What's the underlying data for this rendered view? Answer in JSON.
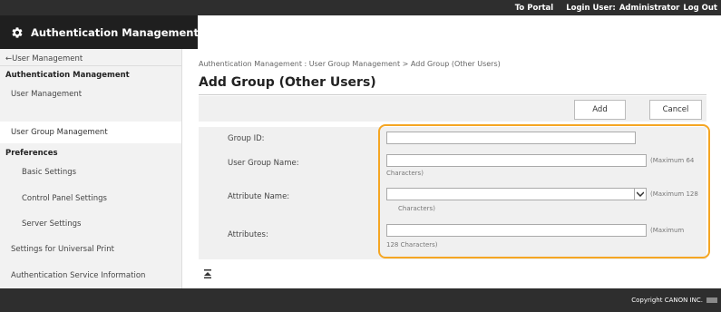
{
  "header": {
    "portal_link": "To Portal",
    "login_user_label": "Login User:",
    "login_user_value": "Administrator",
    "logout": "Log Out",
    "app_title": "Authentication Management"
  },
  "sidebar": {
    "back_link": "←User Management",
    "section_auth": "Authentication Management",
    "user_management": "User Management",
    "user_group_management": "User Group Management",
    "section_preferences": "Preferences",
    "basic_settings": "Basic Settings",
    "control_panel_settings": "Control Panel Settings",
    "server_settings": "Server Settings",
    "universal_print": "Settings for Universal Print",
    "service_information": "Authentication Service Information"
  },
  "main": {
    "breadcrumb": "Authentication Management : User Group Management > Add Group (Other Users)",
    "title": "Add Group (Other Users)",
    "add_button": "Add",
    "cancel_button": "Cancel"
  },
  "form": {
    "group_id_label": "Group ID:",
    "group_id_value": "",
    "user_group_name_label": "User Group Name:",
    "user_group_name_value": "",
    "user_group_name_hint_1": "(Maximum 64",
    "user_group_name_hint_2": "Characters)",
    "attribute_name_label": "Attribute Name:",
    "attribute_name_value": "",
    "attribute_name_hint_1": "(Maximum 128",
    "attribute_name_hint_2": "Characters)",
    "attributes_label": "Attributes:",
    "attributes_value": "",
    "attributes_hint_1": "(Maximum",
    "attributes_hint_2": "128 Characters)"
  },
  "footer": {
    "copyright": "Copyright CANON INC."
  },
  "colors": {
    "header_bg": "#2e2e2e",
    "title_bg": "#1f1f1f",
    "sidebar_bg": "#f2f2f2",
    "panel_bg": "#f0f0f0",
    "highlight": "#f5a623"
  },
  "icons": {
    "app": "gear-icon",
    "select_arrow": "chevron-down-icon",
    "collapse": "collapse-up-icon"
  }
}
